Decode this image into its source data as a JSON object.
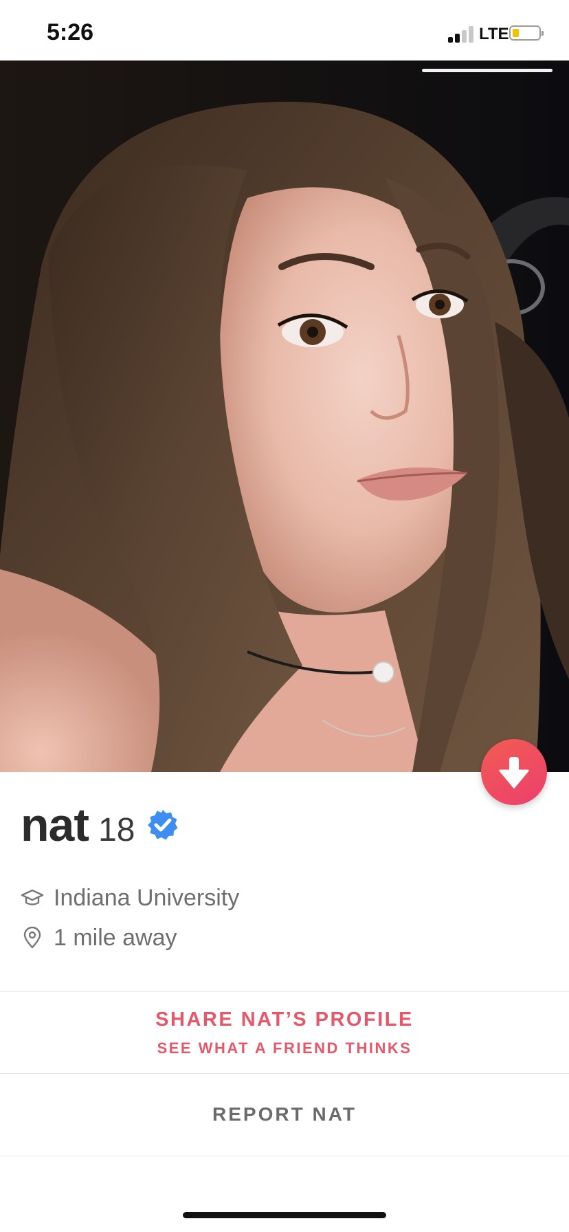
{
  "status_bar": {
    "time": "5:26",
    "network": "LTE",
    "signal_bars_active": 2,
    "signal_bars_total": 4,
    "battery_level": 0.2,
    "battery_color": "#f2c200"
  },
  "photo": {
    "photo_index": 1,
    "photo_count": 1
  },
  "profile": {
    "name": "nat",
    "age": "18",
    "verified": true,
    "school": "Indiana University",
    "distance": "1 mile away",
    "school_icon": "graduation-cap-icon",
    "distance_icon": "location-pin-icon",
    "expand_icon": "arrow-down-icon"
  },
  "actions": {
    "share_title": "SHARE NAT’S PROFILE",
    "share_subtitle": "SEE WHAT A FRIEND THINKS",
    "report": "REPORT NAT"
  },
  "colors": {
    "accent": "#e8566a",
    "fab_gradient_start": "#f25c52",
    "fab_gradient_end": "#ec3f6e",
    "verified": "#3d8ef0"
  }
}
